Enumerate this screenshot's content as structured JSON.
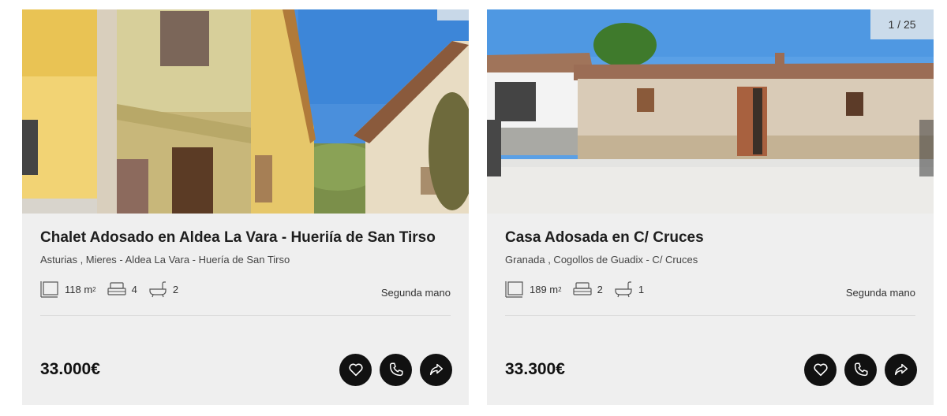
{
  "listings": [
    {
      "title": "Chalet Adosado en Aldea La Vara - Hueriía de San Tirso",
      "location": "Asturias , Mieres - Aldea La Vara - Huería de San Tirso",
      "area": "118 m",
      "area_unit_sup": "2",
      "bedrooms": "4",
      "bathrooms": "2",
      "condition": "Segunda mano",
      "price": "33.000€",
      "photo_counter": ""
    },
    {
      "title": "Casa Adosada en C/ Cruces",
      "location": "Granada , Cogollos de Guadix - C/ Cruces",
      "area": "189 m",
      "area_unit_sup": "2",
      "bedrooms": "2",
      "bathrooms": "1",
      "condition": "Segunda mano",
      "price": "33.300€",
      "photo_counter": "1 / 25"
    }
  ],
  "icons": {
    "area": "area-icon",
    "bed": "bed-icon",
    "bath": "bath-icon",
    "favorite": "heart-icon",
    "call": "phone-icon",
    "share": "share-icon"
  }
}
